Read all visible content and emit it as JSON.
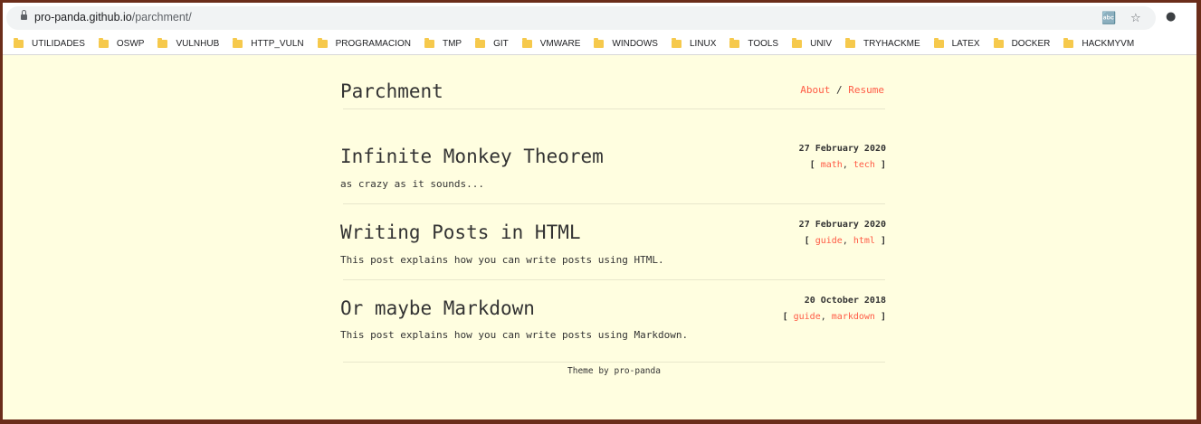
{
  "browser": {
    "url_host": "pro-panda.github.io",
    "url_path": "/parchment/",
    "translate_icon": "translate-icon",
    "star_icon": "star-icon",
    "extension_icon": "extension-icon"
  },
  "bookmarks": [
    {
      "label": "UTILIDADES"
    },
    {
      "label": "OSWP"
    },
    {
      "label": "VULNHUB"
    },
    {
      "label": "HTTP_VULN"
    },
    {
      "label": "PROGRAMACION"
    },
    {
      "label": "TMP"
    },
    {
      "label": "GIT"
    },
    {
      "label": "VMWARE"
    },
    {
      "label": "WINDOWS"
    },
    {
      "label": "LINUX"
    },
    {
      "label": "TOOLS"
    },
    {
      "label": "UNIV"
    },
    {
      "label": "TRYHACKME"
    },
    {
      "label": "LATEX"
    },
    {
      "label": "DOCKER"
    },
    {
      "label": "HACKMYVM"
    }
  ],
  "site": {
    "title": "Parchment",
    "nav_about": "About",
    "nav_sep": "/",
    "nav_resume": "Resume"
  },
  "posts": [
    {
      "title": "Infinite Monkey Theorem",
      "description": "as crazy as it sounds...",
      "date": "27 February 2020",
      "tags": [
        "math",
        "tech"
      ]
    },
    {
      "title": "Writing Posts in HTML",
      "description": "This post explains how you can write posts using HTML.",
      "date": "27 February 2020",
      "tags": [
        "guide",
        "html"
      ]
    },
    {
      "title": "Or maybe Markdown",
      "description": "This post explains how you can write posts using Markdown.",
      "date": "20 October 2018",
      "tags": [
        "guide",
        "markdown"
      ]
    }
  ],
  "footer": {
    "text": "Theme by pro-panda"
  },
  "colors": {
    "page_bg": "#fffee0",
    "accent": "#ff5b45",
    "border": "#6b2d1a"
  }
}
